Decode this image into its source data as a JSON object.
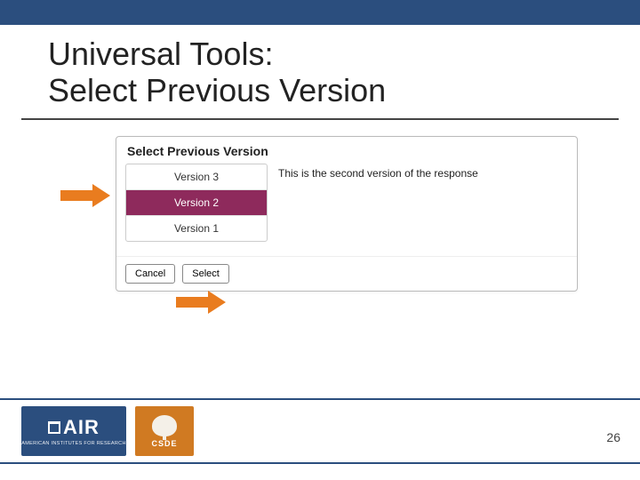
{
  "slide": {
    "title_line1": "Universal Tools:",
    "title_line2": "Select Previous Version",
    "page_number": "26"
  },
  "dialog": {
    "title": "Select Previous Version",
    "versions": [
      {
        "label": "Version 3",
        "selected": false
      },
      {
        "label": "Version 2",
        "selected": true
      },
      {
        "label": "Version 1",
        "selected": false
      }
    ],
    "preview_text": "This is the second version of the response",
    "buttons": {
      "cancel": "Cancel",
      "select": "Select"
    }
  },
  "logos": {
    "air": {
      "text": "AIR",
      "subtitle": "AMERICAN INSTITUTES FOR RESEARCH"
    },
    "csde": {
      "text": "CSDE"
    }
  }
}
